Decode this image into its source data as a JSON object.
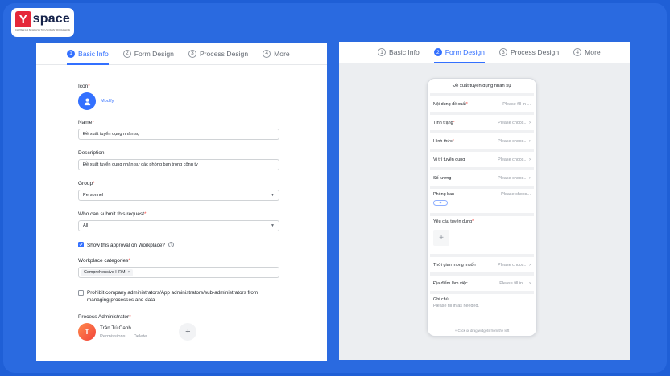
{
  "brand": {
    "letter": "Y",
    "name": "space",
    "tagline": "CHUYÊN GIA SỐ HÓA VÀ TỐI ƯU QUẢN TRỊ DOANH NGHIỆP"
  },
  "left": {
    "tabs": [
      {
        "num": "1",
        "label": "Basic Info"
      },
      {
        "num": "2",
        "label": "Form Design"
      },
      {
        "num": "3",
        "label": "Process Design"
      },
      {
        "num": "4",
        "label": "More"
      }
    ],
    "icon_label": "Icon",
    "modify": "Modify",
    "name_label": "Name",
    "name_value": "Đề xuất tuyển dụng nhân sự",
    "description_label": "Description",
    "description_value": "Đề xuất tuyển dụng nhân sự các phòng ban trong công ty",
    "group_label": "Group",
    "group_value": "Personnel",
    "who_label": "Who can submit this request",
    "who_value": "All",
    "show_workplace": "Show this approval on Workplace?",
    "categories_label": "Workplace categories",
    "category_chip": "Comprehensive HRM",
    "prohibit_text": "Prohibit company administrators/App administrators/sub-administrators from managing processes and data",
    "admin_label": "Process Administrator",
    "admin_name": "Trần Tú Oanh",
    "admin_initial": "T",
    "permissions": "Permissions",
    "delete": "Delete"
  },
  "right": {
    "tabs": [
      {
        "num": "1",
        "label": "Basic Info"
      },
      {
        "num": "2",
        "label": "Form Design"
      },
      {
        "num": "3",
        "label": "Process Design"
      },
      {
        "num": "4",
        "label": "More"
      }
    ],
    "form_title": "Đề xuất tuyển dụng nhân sự",
    "rows": [
      {
        "label": "Nội dung đề xuất",
        "req": true,
        "value": "Please fill in ..."
      },
      {
        "label": "Tình trạng",
        "req": true,
        "value": "Please choos..."
      },
      {
        "label": "Hình thức",
        "req": true,
        "value": "Please choos..."
      },
      {
        "label": "Vị trí tuyển dụng",
        "req": false,
        "value": "Please choos..."
      },
      {
        "label": "Số lượng",
        "req": false,
        "value": "Please choos..."
      }
    ],
    "phong_ban": {
      "label": "Phòng ban",
      "value": "Please choos...",
      "add": "+"
    },
    "yeu_cau": {
      "label": "Yêu cầu tuyển dụng",
      "add": "+"
    },
    "rows2": [
      {
        "label": "Thời gian mong muốn",
        "value": "Please choos..."
      },
      {
        "label": "Địa điểm làm việc",
        "value": "Please fill in ..."
      }
    ],
    "ghi_chu": {
      "label": "Ghi chú",
      "placeholder": "Please fill in as needed."
    },
    "footer": "+ Click or drag widgets from the left"
  }
}
